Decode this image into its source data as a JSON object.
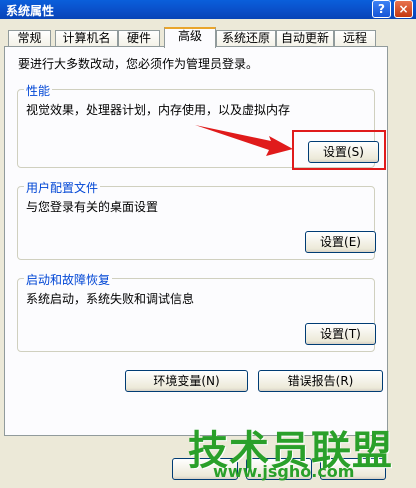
{
  "window": {
    "title": "系统属性",
    "help_label": "?",
    "close_label": "×"
  },
  "tabs": [
    {
      "label": "常规"
    },
    {
      "label": "计算机名"
    },
    {
      "label": "硬件"
    },
    {
      "label": "高级"
    },
    {
      "label": "系统还原"
    },
    {
      "label": "自动更新"
    },
    {
      "label": "远程"
    }
  ],
  "active_tab": "高级",
  "intro_text": "要进行大多数改动，您必须作为管理员登录。",
  "groups": {
    "performance": {
      "title": "性能",
      "description": "视觉效果，处理器计划，内存使用，以及虚拟内存",
      "button_label": "设置(S)"
    },
    "user_profiles": {
      "title": "用户配置文件",
      "description": "与您登录有关的桌面设置",
      "button_label": "设置(E)"
    },
    "startup_recovery": {
      "title": "启动和故障恢复",
      "description": "系统启动，系统失败和调试信息",
      "button_label": "设置(T)"
    }
  },
  "buttons": {
    "env_vars": "环境变量(N)",
    "error_report": "错误报告(R)"
  },
  "watermark": {
    "main": "技术员联盟",
    "url": "www.jsgho.com"
  },
  "colors": {
    "titlebar": "#0a4fc9",
    "group_title": "#0046d5",
    "annotation": "#e01b1b",
    "watermark": "#2aa02a"
  }
}
